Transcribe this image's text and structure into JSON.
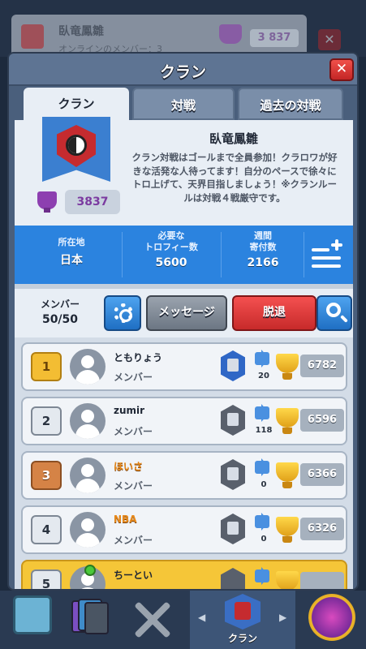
{
  "background": {
    "clan_name": "臥竜鳳雛",
    "online_text": "オンラインのメンバー：3",
    "trophies": "3 837",
    "close_label": "✕"
  },
  "header": {
    "title": "クラン",
    "close_label": "✕"
  },
  "tabs": [
    {
      "label": "クラン",
      "active": true
    },
    {
      "label": "対戦",
      "active": false
    },
    {
      "label": "過去の対戦",
      "active": false
    }
  ],
  "clan": {
    "name": "臥竜鳳雛",
    "description": "クラン対戦はゴールまで全員参加！クラロワが好きな活発な人待ってます！自分のペースで徐々にトロ上げて、天界目指しましょう！※クランルールは対戦４戦厳守です。",
    "trophies": "3837",
    "badge_icon": "yin-yang-badge-icon"
  },
  "stats": {
    "location_label": "所在地",
    "location_value": "日本",
    "required_label_1": "必要な",
    "required_label_2": "トロフィー数",
    "required_value": "5600",
    "donations_label_1": "週間",
    "donations_label_2": "寄付数",
    "donations_value": "2166",
    "add_list_icon": "list-add-icon"
  },
  "members_bar": {
    "label": "メンバー",
    "count": "50/50",
    "message_label": "メッセージ",
    "leave_label": "脱退"
  },
  "members": [
    {
      "rank": "1",
      "name": "ともりょう",
      "role": "メンバー",
      "donations": "20",
      "trophies": "6782"
    },
    {
      "rank": "2",
      "name": "zumir",
      "role": "メンバー",
      "donations": "118",
      "trophies": "6596"
    },
    {
      "rank": "3",
      "name": "ほいさ",
      "role": "メンバー",
      "donations": "0",
      "trophies": "6366"
    },
    {
      "rank": "4",
      "name": "NBA",
      "role": "メンバー",
      "donations": "0",
      "trophies": "6326"
    },
    {
      "rank": "5",
      "name": "ちーとい",
      "role": "",
      "donations": "",
      "trophies": ""
    }
  ],
  "nav": {
    "active_label": "クラン",
    "left_arrow": "◀",
    "right_arrow": "▶"
  },
  "colors": {
    "accent_blue": "#2b83df",
    "leave_red": "#e23d3d",
    "gold_row": "#f5c638",
    "panel": "#4a5f7c"
  }
}
